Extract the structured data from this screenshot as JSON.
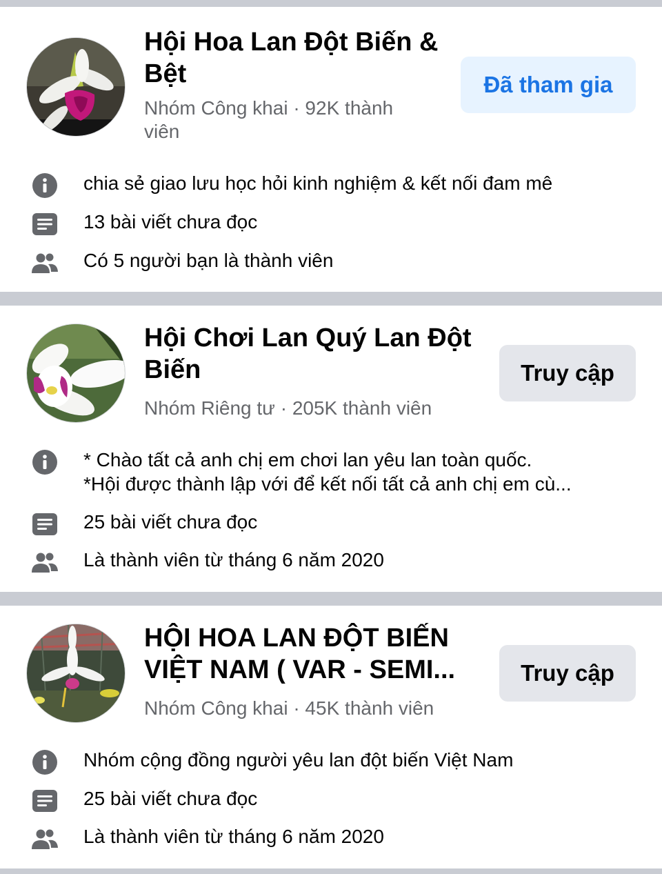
{
  "groups": [
    {
      "name": "Hội Hoa Lan Đột Biến & Bệt",
      "meta": "Nhóm Công khai · 92K thành viên",
      "button": "Đã tham gia",
      "description": "chia sẻ giao lưu học hỏi kinh nghiệm  & kết nối đam mê",
      "unread": "13 bài viết chưa đọc",
      "membership": "Có 5 người bạn là thành viên"
    },
    {
      "name": "Hội Chơi Lan Quý Lan Đột Biến",
      "meta": "Nhóm Riêng tư · 205K thành viên",
      "button": "Truy cập",
      "description_line1": "* Chào tất cả anh chị em chơi lan yêu lan toàn quốc.",
      "description_line2": "*Hội được thành lập với để kết nối tất cả anh chị em cù...",
      "unread": "25 bài viết chưa đọc",
      "membership": "Là thành viên từ tháng 6 năm 2020"
    },
    {
      "name_line1": "HỘI HOA LAN ĐỘT BIẾN",
      "name_line2": "VIỆT NAM ( VAR - SEMI...",
      "meta": "Nhóm Công khai · 45K thành viên",
      "button": "Truy cập",
      "description": "Nhóm cộng đồng người yêu lan đột biến Việt Nam",
      "unread": "25 bài viết chưa đọc",
      "membership": "Là thành viên từ tháng 6 năm 2020"
    }
  ],
  "icons": {
    "info": "info-icon",
    "posts": "posts-icon",
    "members": "people-icon"
  },
  "colors": {
    "separator": "#c9ccd3",
    "joined_button_bg": "#e7f3ff",
    "joined_button_text": "#1b74e4",
    "visit_button_bg": "#e4e6eb",
    "secondary_text": "#65676b",
    "icon": "#65676b"
  }
}
